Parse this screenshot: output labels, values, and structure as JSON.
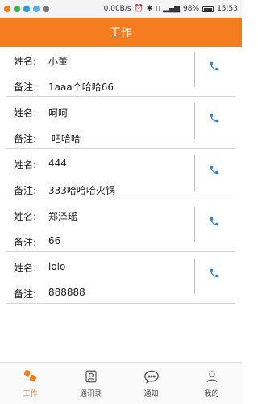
{
  "status_bar": {
    "network_speed": "0.00B/s",
    "battery": "98%",
    "time": "15:53"
  },
  "header": {
    "title": "工作"
  },
  "contacts": [
    {
      "name_label": "姓名:",
      "name": "小董",
      "note_label": "备注:",
      "note": "1aaa个哈哈66"
    },
    {
      "name_label": "姓名:",
      "name": "呵呵",
      "note_label": "备注:",
      "note": " 吧哈哈"
    },
    {
      "name_label": "姓名:",
      "name": "444",
      "note_label": "备注:",
      "note": "333哈哈哈火锅"
    },
    {
      "name_label": "姓名:",
      "name": "郑泽瑶",
      "note_label": "备注:",
      "note": "66"
    },
    {
      "name_label": "姓名:",
      "name": "lolo",
      "note_label": "备注:",
      "note": "888888"
    }
  ],
  "tabs": [
    {
      "label": "工作",
      "icon": "work-icon",
      "active": true
    },
    {
      "label": "通讯录",
      "icon": "contacts-icon",
      "active": false
    },
    {
      "label": "通知",
      "icon": "chat-bubble-icon",
      "active": false
    },
    {
      "label": "我的",
      "icon": "person-icon",
      "active": false
    }
  ],
  "colors": {
    "accent": "#f57c1f",
    "phone_icon": "#2f83d1"
  }
}
